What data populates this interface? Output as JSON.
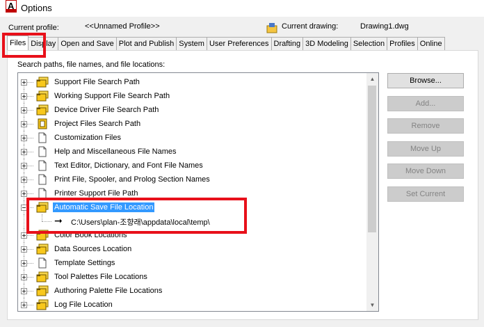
{
  "window": {
    "title": "Options"
  },
  "profile": {
    "current_profile_label": "Current profile:",
    "current_profile_value": "<<Unnamed Profile>>",
    "current_drawing_label": "Current drawing:",
    "current_drawing_value": "Drawing1.dwg"
  },
  "tabs": [
    {
      "label": "Files",
      "active": true
    },
    {
      "label": "Display"
    },
    {
      "label": "Open and Save"
    },
    {
      "label": "Plot and Publish"
    },
    {
      "label": "System"
    },
    {
      "label": "User Preferences"
    },
    {
      "label": "Drafting"
    },
    {
      "label": "3D Modeling"
    },
    {
      "label": "Selection"
    },
    {
      "label": "Profiles"
    },
    {
      "label": "Online"
    }
  ],
  "panel": {
    "caption": "Search paths, file names, and file locations:"
  },
  "tree": {
    "items": [
      {
        "label": "Support File Search Path",
        "icon": "folder-stack-icon"
      },
      {
        "label": "Working Support File Search Path",
        "icon": "folder-stack-icon"
      },
      {
        "label": "Device Driver File Search Path",
        "icon": "folder-stack-icon"
      },
      {
        "label": "Project Files Search Path",
        "icon": "project-files-icon"
      },
      {
        "label": "Customization Files",
        "icon": "document-icon"
      },
      {
        "label": "Help and Miscellaneous File Names",
        "icon": "document-icon"
      },
      {
        "label": "Text Editor, Dictionary, and Font File Names",
        "icon": "document-icon"
      },
      {
        "label": "Print File, Spooler, and Prolog Section Names",
        "icon": "document-icon"
      },
      {
        "label": "Printer Support File Path",
        "icon": "document-icon"
      },
      {
        "label": "Automatic Save File Location",
        "icon": "folder-stack-icon",
        "selected": true,
        "expanded": true
      },
      {
        "label": "C:\\Users\\plan-조향래\\appdata\\local\\temp\\",
        "child": true
      },
      {
        "label": "Color Book Locations",
        "icon": "folder-stack-icon"
      },
      {
        "label": "Data Sources Location",
        "icon": "folder-stack-icon"
      },
      {
        "label": "Template Settings",
        "icon": "document-icon"
      },
      {
        "label": "Tool Palettes File Locations",
        "icon": "folder-stack-icon"
      },
      {
        "label": "Authoring Palette File Locations",
        "icon": "folder-stack-icon"
      },
      {
        "label": "Log File Location",
        "icon": "folder-stack-icon"
      }
    ]
  },
  "buttons": {
    "browse": "Browse...",
    "add": "Add...",
    "remove": "Remove",
    "move_up": "Move Up",
    "move_down": "Move Down",
    "set_current": "Set Current"
  },
  "colors": {
    "highlight_box": "#e8101a",
    "selection": "#3399ff"
  }
}
